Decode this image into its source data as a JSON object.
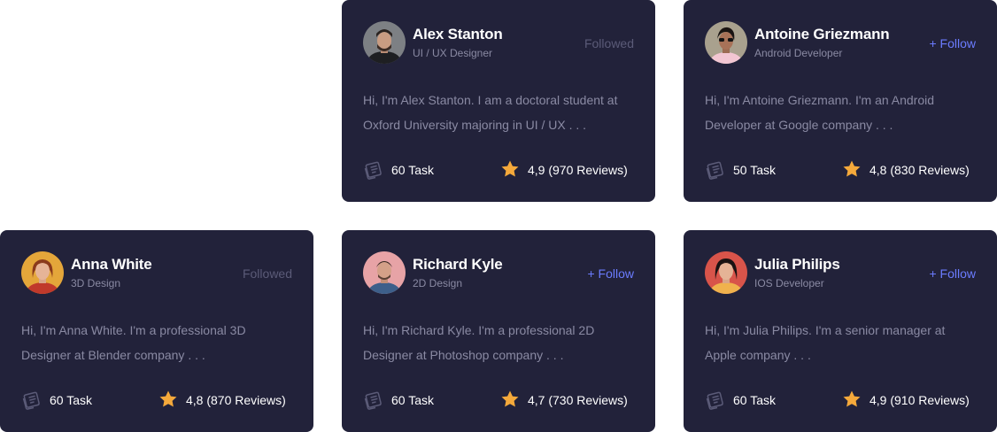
{
  "colors": {
    "card_bg": "#22223a",
    "follow_accent": "#6b7cff",
    "followed_muted": "#5b5b78",
    "star": "#f5a93b",
    "description": "#8a8aa3"
  },
  "cards": [
    {
      "name": "Alex Stanton",
      "role": "UI / UX Designer",
      "follow": "Followed",
      "desc1": "Hi, I'm Alex Stanton. I am a doctoral student at",
      "desc2": "Oxford University majoring in UI / UX  . . .",
      "task": "60 Task",
      "rating": "4,9 (970 Reviews)",
      "avatar_icon": "avatar-alex-stanton"
    },
    {
      "name": "Antoine Griezmann",
      "role": "Android Developer",
      "follow": "+ Follow",
      "desc1": "Hi, I'm Antoine Griezmann. I'm an Android",
      "desc2": "Developer at Google company . . .",
      "task": "50 Task",
      "rating": "4,8 (830 Reviews)",
      "avatar_icon": "avatar-antoine-griezmann"
    },
    {
      "name": "Anna White",
      "role": "3D Design",
      "follow": "Followed",
      "desc1": "Hi, I'm Anna White. I'm a professional 3D",
      "desc2": "Designer at Blender company . . .",
      "task": "60 Task",
      "rating": "4,8 (870 Reviews)",
      "avatar_icon": "avatar-anna-white"
    },
    {
      "name": "Richard Kyle",
      "role": "2D Design",
      "follow": "+ Follow",
      "desc1": "Hi, I'm Richard Kyle. I'm a professional 2D",
      "desc2": "Designer at Photoshop company . . .",
      "task": "60 Task",
      "rating": "4,7 (730 Reviews)",
      "avatar_icon": "avatar-richard-kyle"
    },
    {
      "name": "Julia Philips",
      "role": "IOS Developer",
      "follow": "+ Follow",
      "desc1": "Hi, I'm Julia Philips. I'm a senior manager at",
      "desc2": "Apple company . . .",
      "task": "60 Task",
      "rating": "4,9 (910 Reviews)",
      "avatar_icon": "avatar-julia-philips"
    }
  ]
}
